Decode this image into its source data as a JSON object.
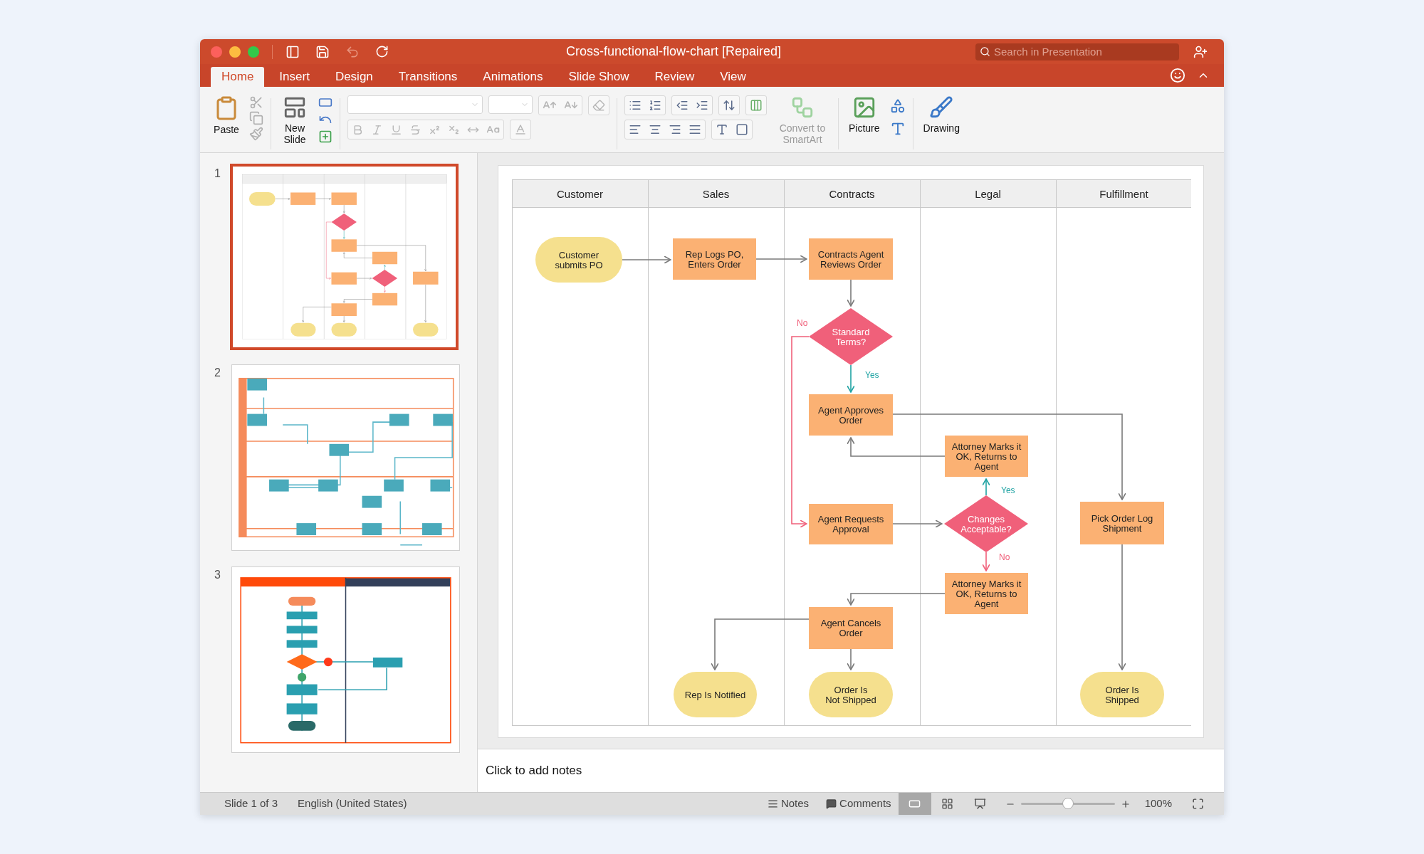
{
  "window": {
    "title": "Cross-functional-flow-chart [Repaired]"
  },
  "search": {
    "placeholder": "Search in Presentation"
  },
  "tabs": [
    {
      "label": "Home",
      "selected": true
    },
    {
      "label": "Insert",
      "selected": false
    },
    {
      "label": "Design",
      "selected": false
    },
    {
      "label": "Transitions",
      "selected": false
    },
    {
      "label": "Animations",
      "selected": false
    },
    {
      "label": "Slide Show",
      "selected": false
    },
    {
      "label": "Review",
      "selected": false
    },
    {
      "label": "View",
      "selected": false
    }
  ],
  "ribbon": [
    {
      "kind": "paste",
      "label": "Paste",
      "disabled": false
    },
    {
      "kind": "new_slide",
      "label": "New Slide",
      "disabled": false
    },
    {
      "kind": "smartart",
      "label": "Convert to SmartArt",
      "disabled": true
    },
    {
      "kind": "picture",
      "label": "Picture",
      "disabled": false
    },
    {
      "kind": "drawing",
      "label": "Drawing",
      "disabled": false
    }
  ],
  "slides": [
    {
      "number": "1",
      "kind": "swimlane",
      "selected": true
    },
    {
      "number": "2",
      "kind": "process",
      "selected": false
    },
    {
      "number": "3",
      "kind": "value",
      "selected": false
    }
  ],
  "diagram": {
    "lanes": [
      "Customer",
      "Sales",
      "Contracts",
      "Legal",
      "Fulfillment"
    ],
    "nodes": [
      {
        "kind": "terminal",
        "lines": [
          "Customer",
          "submits PO"
        ]
      },
      {
        "kind": "process",
        "lines": [
          "Rep Logs PO,",
          "Enters Order"
        ]
      },
      {
        "kind": "process",
        "lines": [
          "Contracts Agent",
          "Reviews Order"
        ]
      },
      {
        "kind": "decision",
        "lines": [
          "Standard",
          "Terms?"
        ]
      },
      {
        "kind": "process",
        "lines": [
          "Agent Approves",
          "Order"
        ]
      },
      {
        "kind": "process",
        "lines": [
          "Attorney Marks it",
          "OK, Returns to",
          "Agent"
        ]
      },
      {
        "kind": "process",
        "lines": [
          "Agent Requests",
          "Approval"
        ]
      },
      {
        "kind": "decision",
        "lines": [
          "Changes",
          "Acceptable?"
        ]
      },
      {
        "kind": "process",
        "lines": [
          "Pick Order Log",
          "Shipment"
        ]
      },
      {
        "kind": "process",
        "lines": [
          "Attorney Marks it",
          "OK, Returns to",
          "Agent"
        ]
      },
      {
        "kind": "process",
        "lines": [
          "Agent Cancels",
          "Order"
        ]
      },
      {
        "kind": "terminal",
        "lines": [
          "Rep Is Notified"
        ]
      },
      {
        "kind": "terminal",
        "lines": [
          "Order Is",
          "Not Shipped"
        ]
      },
      {
        "kind": "terminal",
        "lines": [
          "Order Is",
          "Shipped"
        ]
      }
    ],
    "branch_labels": [
      {
        "kind": "no",
        "text": "No"
      },
      {
        "kind": "yes",
        "text": "Yes"
      },
      {
        "kind": "yes",
        "text": "Yes"
      },
      {
        "kind": "no",
        "text": "No"
      }
    ]
  },
  "notes": {
    "placeholder": "Click to add notes"
  },
  "status_bar": {
    "slide": "Slide 1 of 3",
    "language": "English (United States)",
    "notes": "Notes",
    "comments": "Comments",
    "views": [
      {
        "kind": "normal",
        "selected": true
      },
      {
        "kind": "sorter",
        "selected": false
      },
      {
        "kind": "reading",
        "selected": false
      }
    ],
    "zoom": {
      "level": 0.5,
      "reading": "100%"
    }
  }
}
